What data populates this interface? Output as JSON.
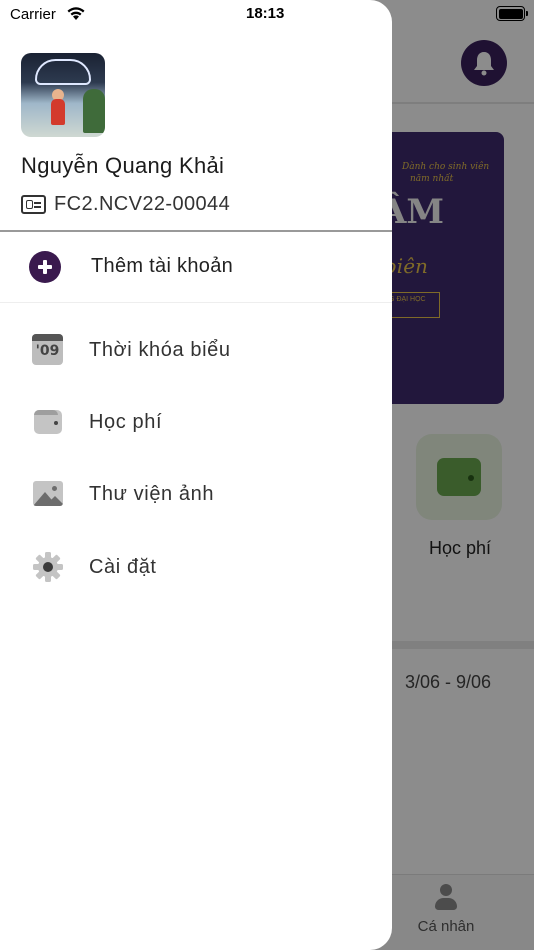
{
  "status_bar": {
    "carrier": "Carrier",
    "time": "18:13"
  },
  "drawer": {
    "user": {
      "name": "Nguyễn Quang Khải",
      "student_id": "FC2.NCV22-00044"
    },
    "add_account_label": "Thêm tài khoản",
    "menu": [
      {
        "label": "Thời khóa biểu",
        "icon": "calendar-icon",
        "icon_text": "'09"
      },
      {
        "label": "Học phí",
        "icon": "wallet-icon"
      },
      {
        "label": "Thư viện ảnh",
        "icon": "photo-library-icon"
      },
      {
        "label": "Cài đặt",
        "icon": "gear-icon"
      }
    ]
  },
  "background": {
    "fee_tile_label": "Học phí",
    "date_range": "3/06 - 9/06",
    "bottom_tab_profile": "Cá nhân",
    "banner": {
      "line1": "Dành cho sinh viên",
      "line2": "năm nhất",
      "headline": "ÂM",
      "script": "biên",
      "badge": "NG ĐẠI HỌC"
    }
  },
  "colors": {
    "accent": "#3a1a4e",
    "banner_bg": "#3e2a6e",
    "fee_tile_bg": "#e9f5e1",
    "fee_icon": "#6aa84f"
  }
}
